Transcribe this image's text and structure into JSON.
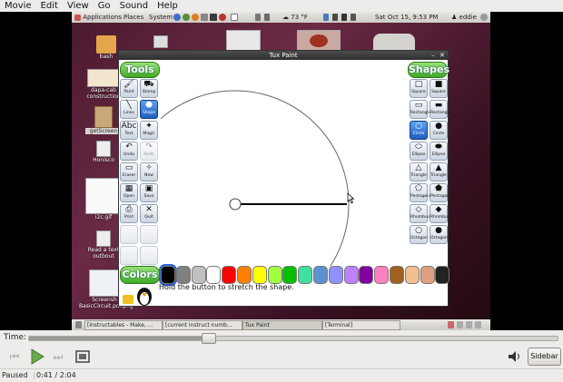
{
  "menubar": {
    "items": [
      "Movie",
      "Edit",
      "View",
      "Go",
      "Sound",
      "Help"
    ]
  },
  "gnome_panel": {
    "applications": "Applications",
    "places": "Places",
    "system": "System",
    "temperature": "73 °F",
    "datetime": "Sat Oct 15,  9:53 PM",
    "user": "eddie"
  },
  "desktop_icons": [
    "bash",
    "dapa-cab construction",
    "getScreen",
    "Honisco",
    "i2c.gif",
    "Read a text outbout",
    "Screensh BasicCircuit.pdf.png"
  ],
  "tuxpaint": {
    "title": "Tux Paint",
    "tools_header": "Tools",
    "shapes_header": "Shapes",
    "colors_header": "Colors",
    "hint": "Hold the button to stretch the shape.",
    "tools": [
      {
        "label": "Paint",
        "glyph": "🖌"
      },
      {
        "label": "Stamp",
        "glyph": "⛟"
      },
      {
        "label": "Lines",
        "glyph": "╲"
      },
      {
        "label": "Shape",
        "glyph": "⬣"
      },
      {
        "label": "Text",
        "glyph": "Abc"
      },
      {
        "label": "Magic",
        "glyph": "✦"
      },
      {
        "label": "Undo",
        "glyph": "↶"
      },
      {
        "label": "Redo",
        "glyph": "↷"
      },
      {
        "label": "Eraser",
        "glyph": "▭"
      },
      {
        "label": "New",
        "glyph": "✧"
      },
      {
        "label": "Open",
        "glyph": "▦"
      },
      {
        "label": "Save",
        "glyph": "▣"
      },
      {
        "label": "Print",
        "glyph": "⎙"
      },
      {
        "label": "Quit",
        "glyph": "✕"
      }
    ],
    "shapes": [
      {
        "label": "Square",
        "glyph": "□"
      },
      {
        "label": "Square",
        "glyph": "■"
      },
      {
        "label": "Rectangle",
        "glyph": "▭"
      },
      {
        "label": "Rectangle",
        "glyph": "▬"
      },
      {
        "label": "Circle",
        "glyph": "○"
      },
      {
        "label": "Circle",
        "glyph": "●"
      },
      {
        "label": "Ellipse",
        "glyph": "⬭"
      },
      {
        "label": "Ellipse",
        "glyph": "⬬"
      },
      {
        "label": "Triangle",
        "glyph": "△"
      },
      {
        "label": "Triangle",
        "glyph": "▲"
      },
      {
        "label": "Pentagon",
        "glyph": "⬠"
      },
      {
        "label": "Pentagon",
        "glyph": "⬟"
      },
      {
        "label": "Rhombus",
        "glyph": "◇"
      },
      {
        "label": "Rhombus",
        "glyph": "◆"
      },
      {
        "label": "Octagon",
        "glyph": "○"
      },
      {
        "label": "Octagon",
        "glyph": "●"
      }
    ],
    "colors": [
      "#000000",
      "#808080",
      "#c0c0c0",
      "#ffffff",
      "#ff0000",
      "#ff8000",
      "#ffff00",
      "#a0ff40",
      "#00c000",
      "#40e0a0",
      "#6090d0",
      "#9090ff",
      "#c080ff",
      "#8000a0",
      "#ff80c0",
      "#a06020",
      "#f0c090",
      "#e0a080",
      "#222222"
    ]
  },
  "taskbar": {
    "tasks": [
      "[instructables - Make, ...",
      "[current instruct numb...",
      "Tux Paint",
      "[Terminal]"
    ]
  },
  "player": {
    "time_label": "Time:",
    "position_fraction": 0.338,
    "sidebar_label": "Sidebar",
    "status": "Paused",
    "time_readout": "0:41 / 2:04"
  }
}
